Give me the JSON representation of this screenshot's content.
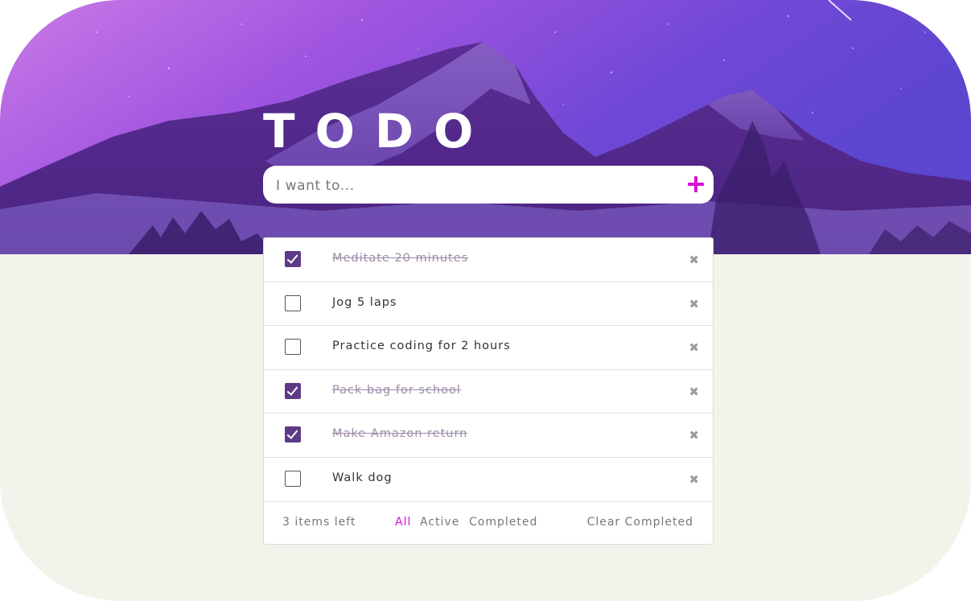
{
  "app": {
    "title": "TODO"
  },
  "new_todo": {
    "placeholder": "I want to...",
    "value": ""
  },
  "todos": [
    {
      "text": "Meditate 20 minutes",
      "completed": true
    },
    {
      "text": "Jog 5 laps",
      "completed": false
    },
    {
      "text": "Practice coding for 2 hours",
      "completed": false
    },
    {
      "text": "Pack bag for school",
      "completed": true
    },
    {
      "text": "Make Amazon return",
      "completed": true
    },
    {
      "text": "Walk dog",
      "completed": false
    }
  ],
  "footer": {
    "items_left": "3 items left",
    "filters": {
      "all": "All",
      "active": "Active",
      "completed": "Completed"
    },
    "active_filter": "All",
    "clear_completed": "Clear Completed"
  },
  "icons": {
    "add": "plus-icon",
    "delete": "close-icon",
    "check": "checkmark-icon"
  },
  "colors": {
    "accent": "#d80fd8",
    "checkbox_checked": "#5e3a86",
    "page_background": "#f3f2eb",
    "hero_gradient": [
      "#c66ae0",
      "#7a3fd4",
      "#5a44c8"
    ]
  }
}
